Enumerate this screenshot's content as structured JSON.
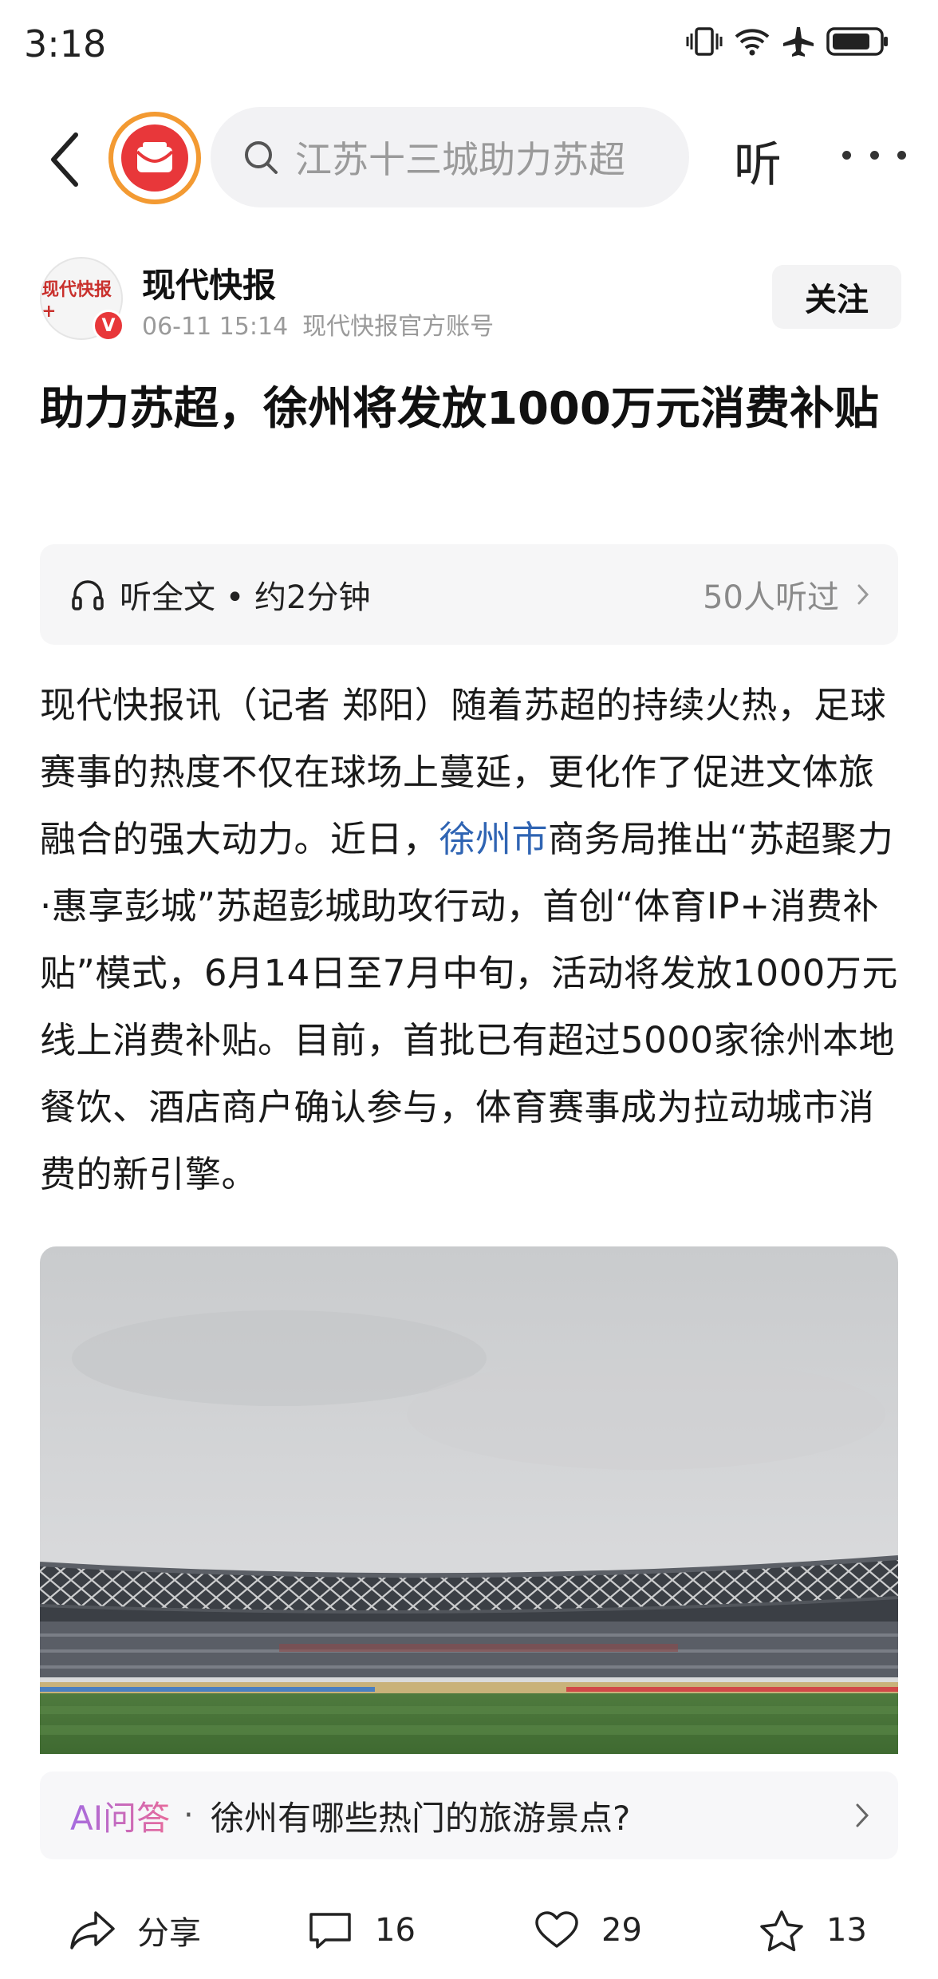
{
  "status_bar": {
    "time": "3:18"
  },
  "top_bar": {
    "search_placeholder": "江苏十三城助力苏超",
    "listen_label": "听"
  },
  "author": {
    "name": "现代快报",
    "avatar_text": "现代快报+",
    "verified_mark": "V",
    "date": "06-11 15:14",
    "account_type": "现代快报官方账号",
    "follow_label": "关注"
  },
  "article": {
    "title": "助力苏超，徐州将发放1000万元消费补贴",
    "listen_full": "听全文 • 约2分钟",
    "listen_count": "50人听过",
    "body_part1": "现代快报讯（记者 郑阳）随着苏超的持续火热，足球赛事的热度不仅在球场上蔓延，更化作了促进文体旅融合的强大动力。近日，",
    "body_link": "徐州市",
    "body_part2": "商务局推出“苏超聚力·惠享彭城”苏超彭城助攻行动，首创“体育IP+消费补贴”模式，6月14日至7月中旬，活动将发放1000万元线上消费补贴。目前，首批已有超过5000家徐州本地餐饮、酒店商户确认参与，体育赛事成为拉动城市消费的新引擎。"
  },
  "ai": {
    "label": "AI问答",
    "dot": "·",
    "question": "徐州有哪些热门的旅游景点?"
  },
  "actions": {
    "share": "分享",
    "comments": "16",
    "likes": "29",
    "favorites": "13"
  },
  "colors": {
    "link": "#2f64b3",
    "logo_ring": "#f39a32",
    "logo_fill": "#e8373a"
  }
}
